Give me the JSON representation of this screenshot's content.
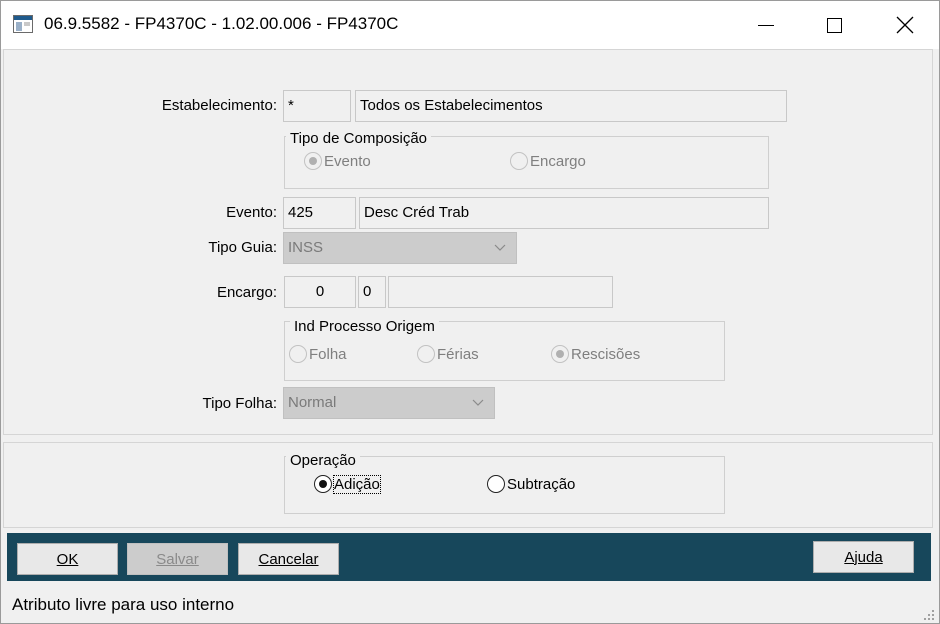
{
  "window": {
    "title": "06.9.5582 - FP4370C - 1.02.00.006 - FP4370C"
  },
  "form": {
    "estabelecimento": {
      "label": "Estabelecimento:",
      "code": "*",
      "description": "Todos os Estabelecimentos"
    },
    "tipo_composicao": {
      "title": "Tipo de Composição",
      "options": [
        {
          "label": "Evento",
          "selected": true
        },
        {
          "label": "Encargo",
          "selected": false
        }
      ]
    },
    "evento": {
      "label": "Evento:",
      "code": "425",
      "description": "Desc Créd Trab"
    },
    "tipo_guia": {
      "label": "Tipo Guia:",
      "value": "INSS"
    },
    "encargo": {
      "label": "Encargo:",
      "value1": "0",
      "value2": "0",
      "description": ""
    },
    "ind_processo_origem": {
      "title": "Ind Processo Origem",
      "options": [
        {
          "label": "Folha",
          "selected": false
        },
        {
          "label": "Férias",
          "selected": false
        },
        {
          "label": "Rescisões",
          "selected": true
        }
      ]
    },
    "tipo_folha": {
      "label": "Tipo Folha:",
      "value": "Normal"
    }
  },
  "operacao": {
    "title": "Operação",
    "options": [
      {
        "label": "Adição",
        "selected": true
      },
      {
        "label": "Subtração",
        "selected": false
      }
    ]
  },
  "buttons": {
    "ok": "OK",
    "salvar": "Salvar",
    "cancelar": "Cancelar",
    "ajuda": "Ajuda"
  },
  "status": {
    "text": "Atributo livre para uso interno"
  },
  "colors": {
    "button_bar": "#17475b",
    "disabled_field": "#cccccc"
  }
}
